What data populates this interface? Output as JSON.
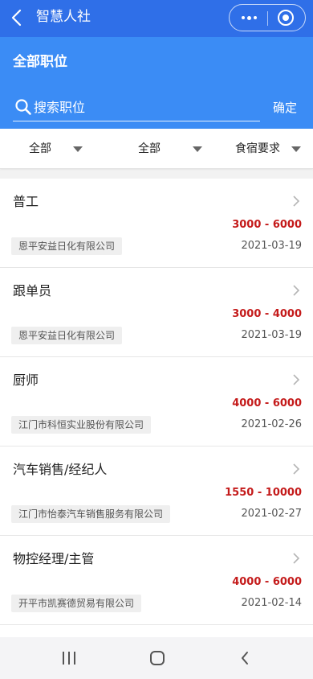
{
  "appbar": {
    "title": "智慧人社"
  },
  "header": {
    "section_title": "全部职位"
  },
  "search": {
    "placeholder": "搜索职位",
    "confirm_label": "确定"
  },
  "filters": [
    {
      "label": "全部"
    },
    {
      "label": "全部"
    },
    {
      "label": "食宿要求"
    }
  ],
  "jobs": [
    {
      "title": "普工",
      "salary": "3000 - 6000",
      "company": "恩平安益日化有限公司",
      "date": "2021-03-19"
    },
    {
      "title": "跟单员",
      "salary": "3000 - 4000",
      "company": "恩平安益日化有限公司",
      "date": "2021-03-19"
    },
    {
      "title": "厨师",
      "salary": "4000 - 6000",
      "company": "江门市科恒实业股份有限公司",
      "date": "2021-02-26"
    },
    {
      "title": "汽车销售/经纪人",
      "salary": "1550 - 10000",
      "company": "江门市怡泰汽车销售服务有限公司",
      "date": "2021-02-27"
    },
    {
      "title": "物控经理/主管",
      "salary": "4000 - 6000",
      "company": "开平市凯赛德贸易有限公司",
      "date": "2021-02-14"
    }
  ],
  "colors": {
    "appbar": "#2f6fe8",
    "header": "#3b8cf5",
    "salary": "#c41a1a"
  }
}
